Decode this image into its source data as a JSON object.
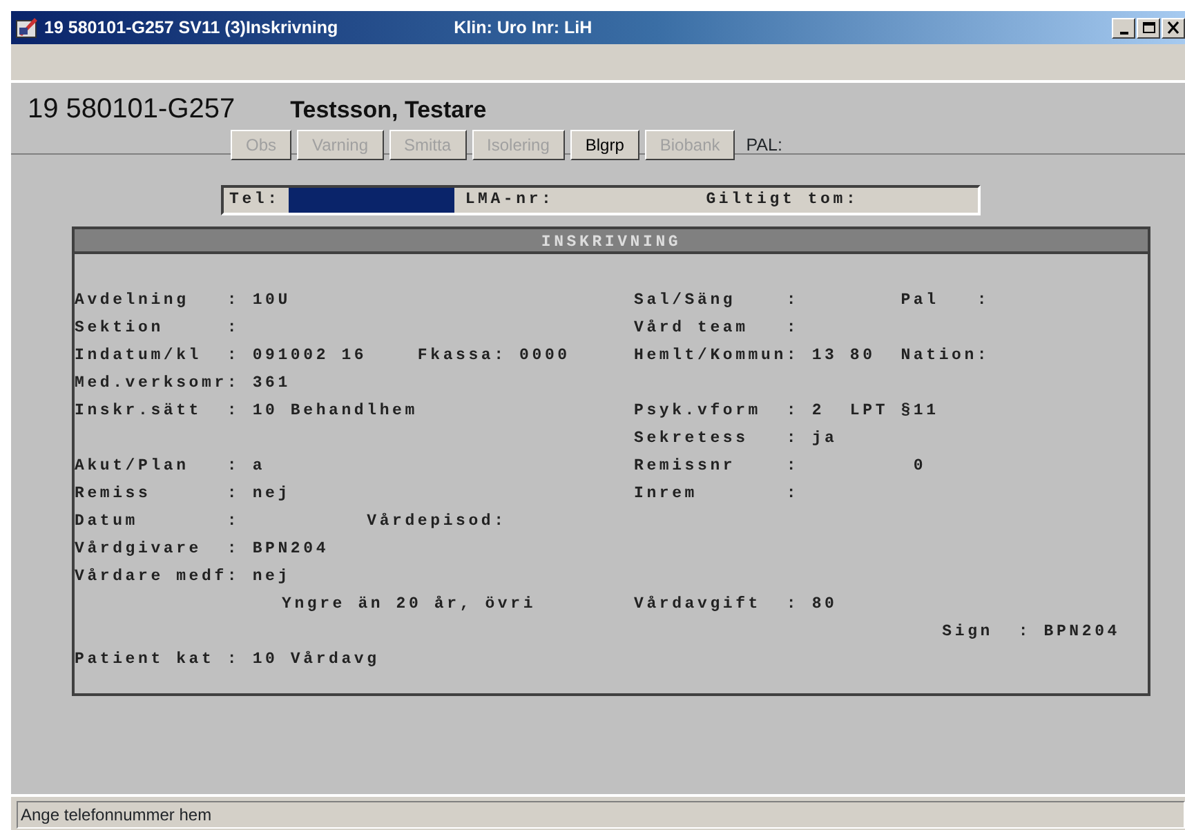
{
  "window": {
    "title": "19 580101-G257  SV11 (3)Inskrivning",
    "subtitle": "Klin: Uro  Inr: LiH"
  },
  "patient": {
    "id": "19 580101-G257",
    "name": "Testsson, Testare"
  },
  "buttons": [
    {
      "label": "Obs",
      "disabled": true
    },
    {
      "label": "Varning",
      "disabled": true
    },
    {
      "label": "Smitta",
      "disabled": true
    },
    {
      "label": "Isolering",
      "disabled": true
    },
    {
      "label": "Blgrp",
      "disabled": false
    },
    {
      "label": "Biobank",
      "disabled": true
    }
  ],
  "pal_label": "PAL:",
  "contact": {
    "tel_label": "Tel:",
    "tel_focused": true,
    "lma_label": "LMA-nr:",
    "valid_label": "Giltigt tom:"
  },
  "panel": {
    "title": "INSKRIVNING",
    "rows": [
      {
        "kind": "field",
        "left": "Avdelning   : 10U",
        "right": "Sal/Säng    :        Pal   :"
      },
      {
        "kind": "field",
        "left": "Sektion     :",
        "right": "Vård team   :"
      },
      {
        "kind": "field",
        "left": "Indatum/kl  : 091002 16    Fkassa: 0000",
        "right": "Hemlt/Kommun: 13 80  Nation:"
      },
      {
        "kind": "field",
        "left": "Med.verksomr: 361"
      },
      {
        "kind": "field",
        "left": "Inskr.sätt  : 10 Behandlhem",
        "right": "Psyk.vform  : 2  LPT §11"
      },
      {
        "kind": "field",
        "right": "Sekretess   : ja"
      },
      {
        "kind": "field",
        "left": "Akut/Plan   : a",
        "right": "Remissnr    :         0"
      },
      {
        "kind": "field",
        "left": "Remiss      : nej",
        "right": "Inrem       :"
      },
      {
        "kind": "field",
        "left": "Datum       :          Vårdepisod:"
      },
      {
        "kind": "field",
        "left": "Vårdgivare  : BPN204"
      },
      {
        "kind": "field",
        "left": "Vårdare medf: nej"
      },
      {
        "kind": "note",
        "left": "Yngre än 20 år, övri",
        "right": "Vårdavgift  : 80"
      },
      {
        "kind": "sign",
        "right": "Sign  : BPN204"
      },
      {
        "kind": "field",
        "left": "Patient kat : 10 Vårdavg"
      }
    ]
  },
  "status_bar": "Ange telefonnummer hem"
}
